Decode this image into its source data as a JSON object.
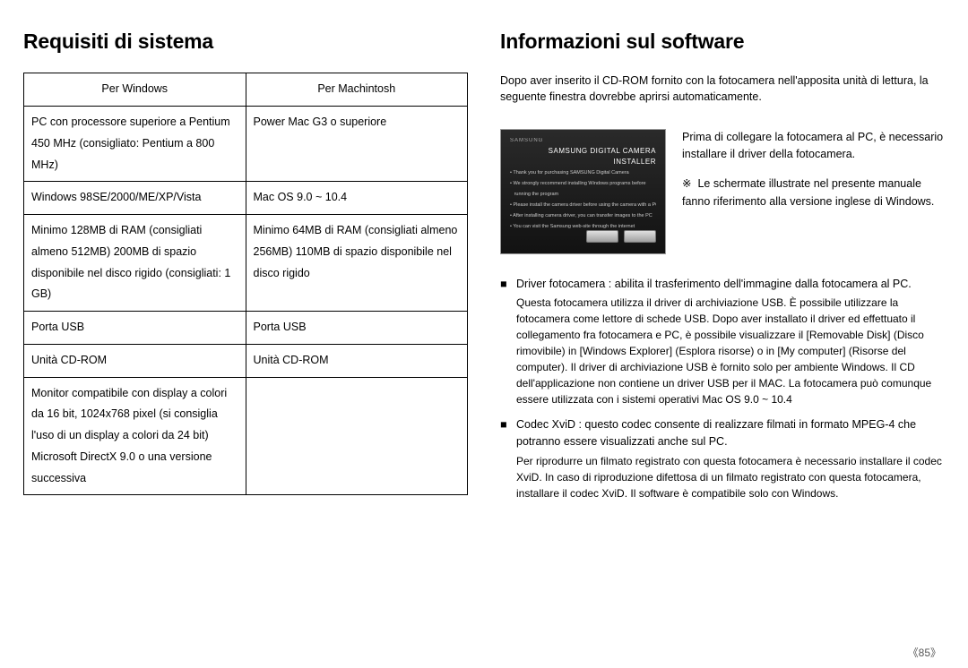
{
  "left": {
    "heading": "Requisiti di sistema",
    "table": {
      "headers": [
        "Per Windows",
        "Per Machintosh"
      ],
      "rows": [
        [
          "PC con processore superiore a Pentium 450 MHz (consigliato: Pentium a 800 MHz)",
          "Power Mac G3 o superiore"
        ],
        [
          "Windows 98SE/2000/ME/XP/Vista",
          "Mac OS 9.0 ~ 10.4"
        ],
        [
          "Minimo 128MB di RAM (consigliati almeno 512MB) 200MB di spazio disponibile nel disco rigido (consigliati: 1 GB)",
          "Minimo 64MB di RAM (consigliati almeno 256MB) 110MB di spazio disponibile nel disco rigido"
        ],
        [
          "Porta USB",
          "Porta USB"
        ],
        [
          "Unità CD-ROM",
          "Unità CD-ROM"
        ],
        [
          "Monitor compatibile con display a colori da 16 bit, 1024x768 pixel (si consiglia l'uso di un display a colori da 24 bit) Microsoft DirectX 9.0 o una versione successiva",
          ""
        ]
      ]
    }
  },
  "right": {
    "heading": "Informazioni sul software",
    "intro": "Dopo aver inserito il CD-ROM fornito con la fotocamera nell'apposita unità di lettura, la seguente finestra dovrebbe aprirsi automaticamente.",
    "installer_img": {
      "brand": "SAMSUNG",
      "title": "SAMSUNG DIGITAL CAMERA INSTALLER"
    },
    "fig_text": "Prima di collegare la fotocamera al PC, è necessario installare il driver della fotocamera.",
    "note_symbol": "※",
    "note": "Le schermate illustrate nel presente manuale fanno riferimento alla versione inglese di Windows.",
    "items": [
      {
        "lead": "Driver fotocamera : abilita il trasferimento dell'immagine dalla fotocamera al PC.",
        "desc": "Questa fotocamera utilizza il driver di archiviazione USB. È possibile utilizzare la fotocamera come lettore di schede USB. Dopo aver installato il driver ed effettuato il collegamento fra fotocamera e PC, è possibile visualizzare il [Removable Disk] (Disco rimovibile) in [Windows Explorer] (Esplora risorse) o in [My computer] (Risorse del computer). Il driver di archiviazione USB è fornito solo per ambiente Windows. Il CD dell'applicazione non contiene un driver USB per il MAC. La fotocamera può comunque essere utilizzata con i sistemi operativi Mac OS 9.0 ~ 10.4"
      },
      {
        "lead": "Codec XviD : questo codec consente di realizzare filmati in formato MPEG-4 che potranno essere visualizzati anche sul PC.",
        "desc": "Per riprodurre un filmato registrato con questa fotocamera è necessario installare il codec XviD. In caso di riproduzione difettosa di un filmato registrato con questa fotocamera, installare il codec XviD. Il software è compatibile solo con Windows."
      }
    ]
  },
  "page_number": "《85》"
}
